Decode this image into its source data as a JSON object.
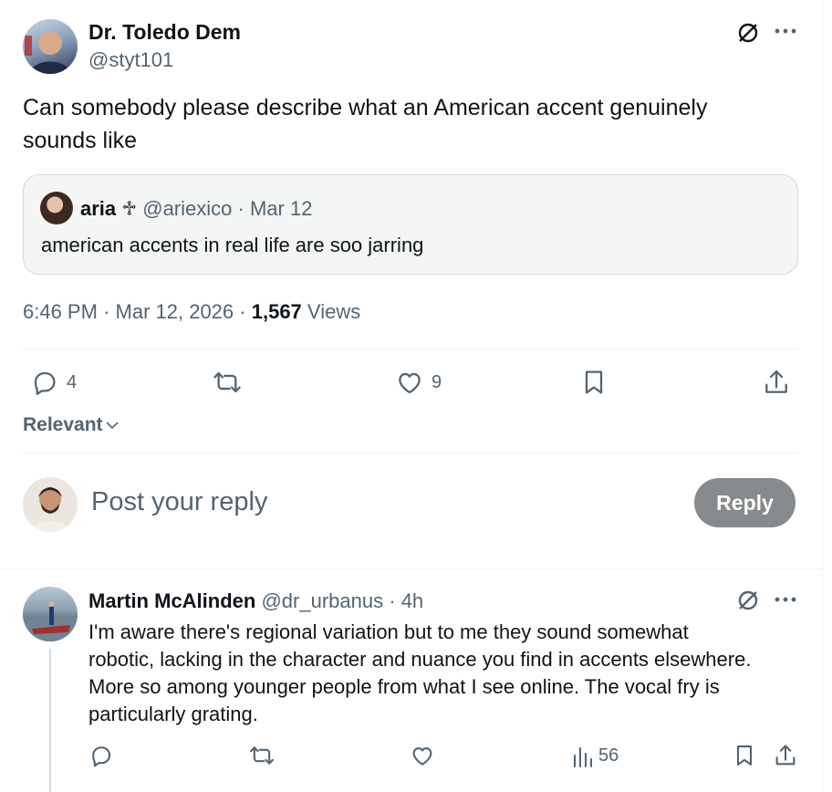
{
  "post": {
    "author_name": "Dr. Toledo Dem",
    "author_handle": "@styt101",
    "text_line1": "Can somebody please describe what an American accent genuinely",
    "text_line2": "sounds like",
    "quote": {
      "name": "aria ♱",
      "handle": "@ariexico",
      "date": "Mar 12",
      "text": "american accents in real life are soo jarring"
    },
    "time": "6:46 PM",
    "date": "Mar 12, 2026",
    "views_count": "1,567",
    "views_label": "Views",
    "replies": "4",
    "likes": "9"
  },
  "sort": {
    "label": "Relevant"
  },
  "composer": {
    "placeholder": "Post your reply",
    "button_label": "Reply"
  },
  "reply": {
    "author_name": "Martin McAlinden",
    "author_handle": "@dr_urbanus",
    "time": "4h",
    "lines": [
      "I'm aware there's regional variation but to me they sound somewhat",
      "robotic, lacking in the character and nuance you find in accents elsewhere.",
      "More so among younger people from what I see online. The vocal fry is",
      "particularly grating."
    ],
    "views": "56"
  },
  "separator": "·",
  "icons": [
    "grok-icon",
    "more-icon",
    "reply-icon",
    "repost-icon",
    "like-icon",
    "bookmark-icon",
    "share-icon",
    "views-icon",
    "chevron-down-icon"
  ],
  "colors": {
    "text": "#0f1419",
    "muted": "#536471",
    "reply_button": "#878a8c",
    "border": "#eff3f4"
  }
}
